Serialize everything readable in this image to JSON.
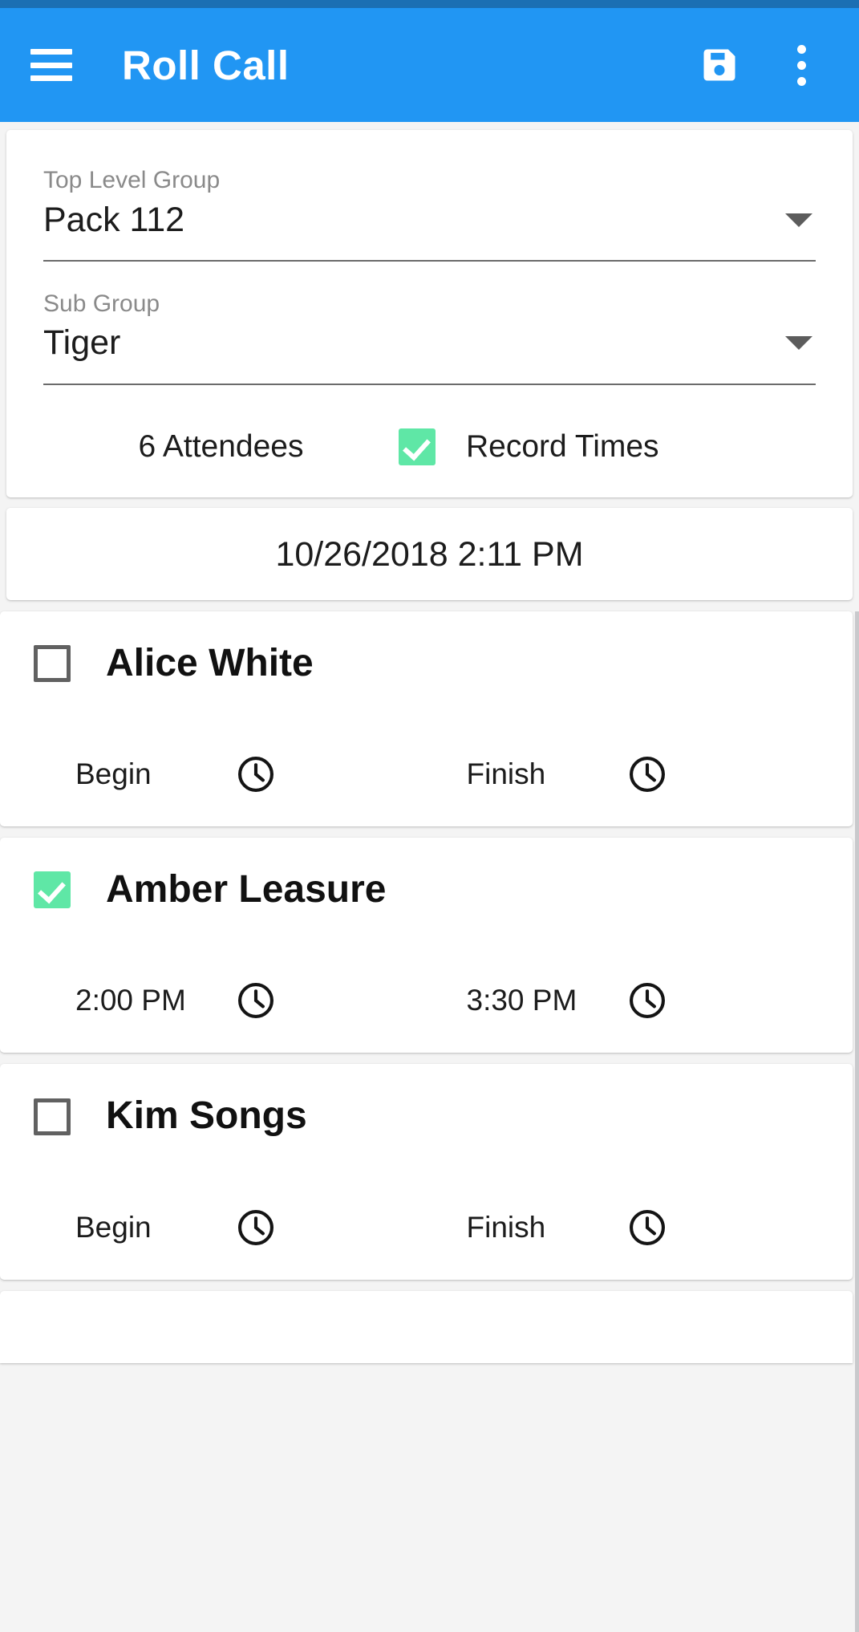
{
  "app_bar": {
    "title": "Roll Call",
    "menu_icon": "hamburger-menu-icon",
    "save_icon": "save-floppy-disk-icon",
    "overflow_icon": "overflow-menu-icon",
    "background_color": "#2196f3",
    "status_bar_color": "#1b6fb3"
  },
  "form": {
    "top_level_group": {
      "label": "Top Level Group",
      "value": "Pack 112"
    },
    "sub_group": {
      "label": "Sub Group",
      "value": "Tiger"
    },
    "attendee_count_text": "6 Attendees",
    "record_times": {
      "label": "Record Times",
      "checked": true
    }
  },
  "session": {
    "datetime": "10/26/2018 2:11 PM"
  },
  "labels": {
    "begin_placeholder": "Begin",
    "finish_placeholder": "Finish"
  },
  "colors": {
    "checkbox_checked": "#5fe7a6",
    "checkbox_unchecked_border": "#616161",
    "accent": "#2196f3"
  },
  "attendees": [
    {
      "name": "Alice White",
      "checked": false,
      "begin_time": "Begin",
      "finish_time": "Finish"
    },
    {
      "name": "Amber Leasure",
      "checked": true,
      "begin_time": "2:00 PM",
      "finish_time": "3:30 PM"
    },
    {
      "name": "Kim Songs",
      "checked": false,
      "begin_time": "Begin",
      "finish_time": "Finish"
    }
  ]
}
